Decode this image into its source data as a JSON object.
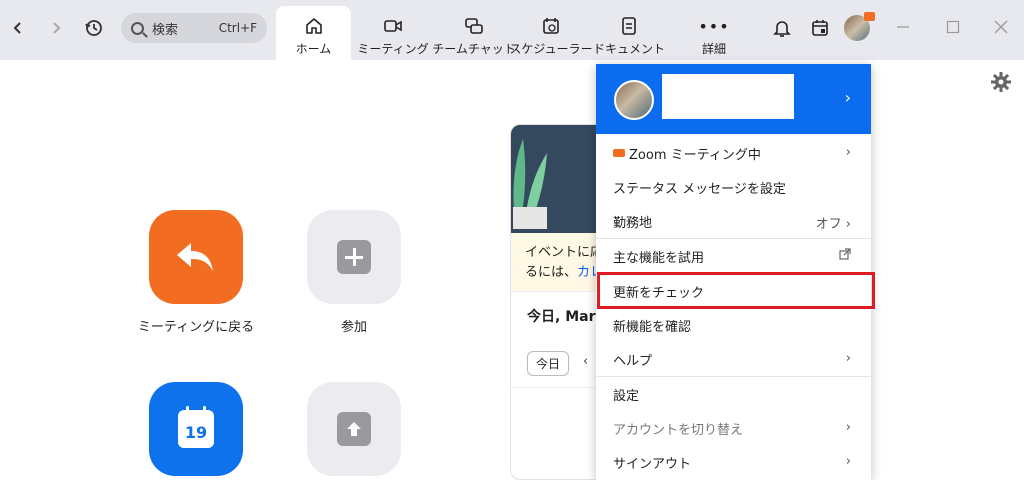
{
  "nav": {
    "back_icon": "chevron-left-icon",
    "forward_icon": "chevron-right-icon",
    "history_icon": "history-icon"
  },
  "search": {
    "placeholder": "検索",
    "shortcut": "Ctrl+F"
  },
  "tabs": [
    {
      "label": "ホーム",
      "icon": "home-icon",
      "active": true
    },
    {
      "label": "ミーティング",
      "icon": "video-icon"
    },
    {
      "label": "チームチャット",
      "icon": "chat-icon"
    },
    {
      "label": "スケジューラー",
      "icon": "scheduler-icon"
    },
    {
      "label": "ドキュメント",
      "icon": "document-icon"
    },
    {
      "label": "詳細",
      "icon": "more-icon"
    }
  ],
  "colors": {
    "accent": "#0b6cf0",
    "orange": "#f26d21",
    "highlight": "#e01b24",
    "gray_tile": "#ececf0"
  },
  "home": {
    "tiles": [
      {
        "label": "ミーティングに戻る",
        "icon": "return-arrow-icon"
      },
      {
        "label": "参加",
        "icon": "plus-icon"
      },
      {
        "label": "",
        "icon": "calendar-icon",
        "day": "19"
      },
      {
        "label": "",
        "icon": "share-upload-icon"
      }
    ]
  },
  "card": {
    "promo_line1": "イベントに応",
    "promo_line2_prefix": "るには、",
    "promo_link": "カレ",
    "today_title": "今日, Mar",
    "today_button": "今日"
  },
  "menu": {
    "items": [
      {
        "label": "Zoom ミーティング中",
        "has_chevron": true
      },
      {
        "label": "ステータス メッセージを設定"
      },
      {
        "label": "勤務地",
        "value": "オフ",
        "has_chevron": true
      },
      {
        "label": "主な機能を試用",
        "icon": "external-link-icon"
      },
      {
        "label": "更新をチェック",
        "highlighted": true
      },
      {
        "label": "新機能を確認"
      },
      {
        "label": "ヘルプ",
        "has_chevron": true
      },
      {
        "label": "設定"
      },
      {
        "label": "アカウントを切り替え",
        "has_chevron": true,
        "disabled": true
      },
      {
        "label": "サインアウト",
        "has_chevron": true
      }
    ]
  }
}
